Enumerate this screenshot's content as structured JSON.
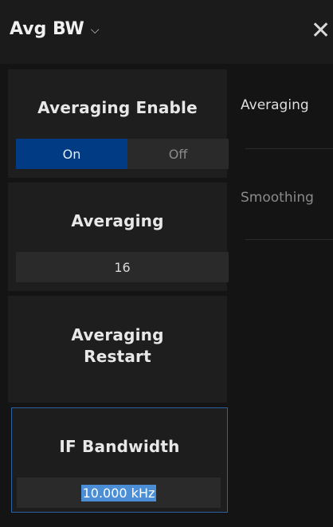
{
  "header": {
    "title": "Avg BW",
    "menu_icon": "chevron-down-icon",
    "close_icon": "close-icon"
  },
  "panels": {
    "averaging_enable": {
      "title": "Averaging Enable",
      "on_label": "On",
      "off_label": "Off",
      "selected": "On"
    },
    "averaging": {
      "title": "Averaging",
      "value": "16"
    },
    "averaging_restart": {
      "title_line1": "Averaging",
      "title_line2": "Restart"
    },
    "if_bandwidth": {
      "title": "IF Bandwidth",
      "value": "10.000 kHz"
    }
  },
  "right_column": {
    "averaging_label": "Averaging",
    "smoothing_label": "Smoothing"
  },
  "colors": {
    "accent": "#003b83",
    "selection_highlight": "#4c8ed6",
    "panel_bg": "#1e1e1e",
    "value_bg": "#2a2a2a"
  }
}
